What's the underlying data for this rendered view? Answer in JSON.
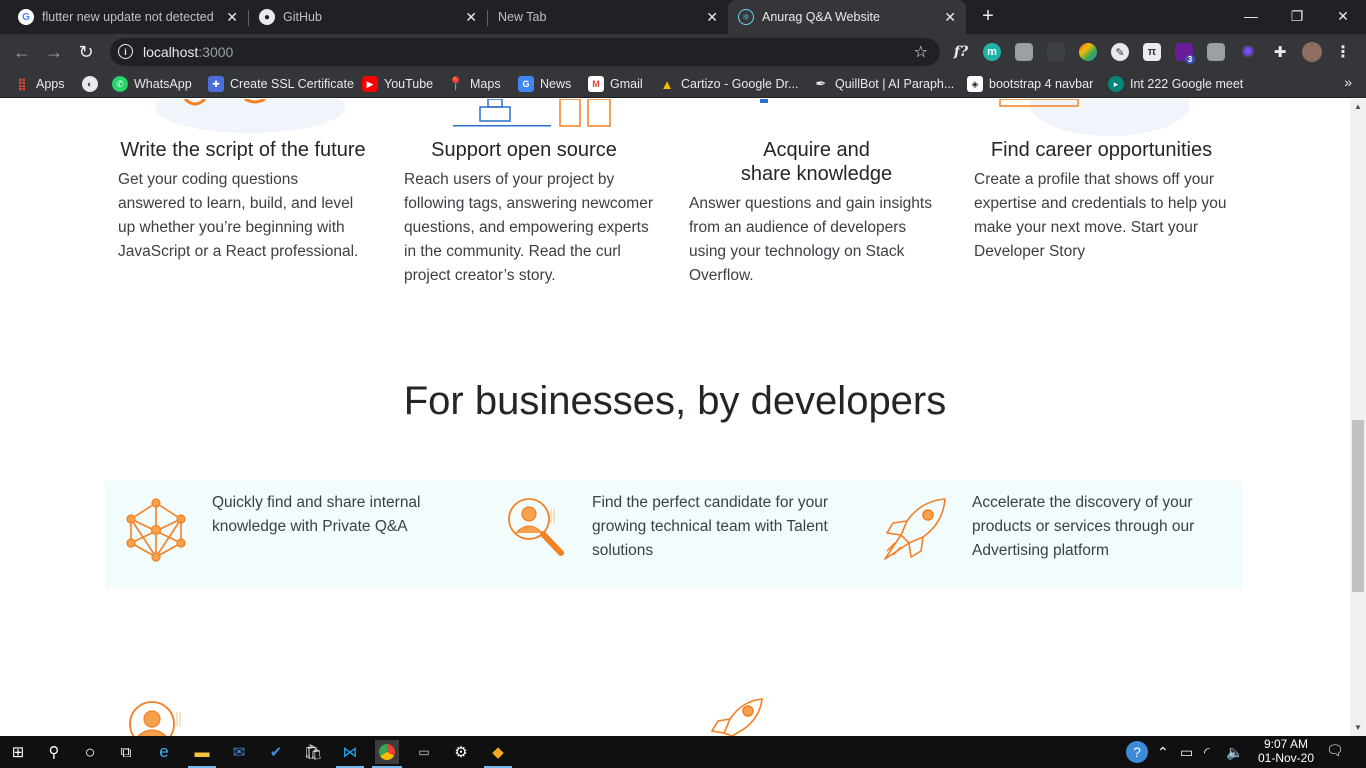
{
  "browser": {
    "tabs": [
      {
        "title": "flutter new update not detected",
        "favicon": "google-icon"
      },
      {
        "title": "GitHub",
        "favicon": "github-icon"
      },
      {
        "title": "New Tab",
        "favicon": ""
      },
      {
        "title": "Anurag Q&A Website",
        "favicon": "react-icon"
      }
    ],
    "url_host": "localhost",
    "url_port": ":3000",
    "bookmarks": [
      {
        "label": "Apps",
        "icon": "apps-grid-icon"
      },
      {
        "label": "",
        "icon": "globe-icon"
      },
      {
        "label": "WhatsApp",
        "icon": "whatsapp-icon"
      },
      {
        "label": "Create SSL Certificate",
        "icon": "puzzle-icon"
      },
      {
        "label": "YouTube",
        "icon": "youtube-icon"
      },
      {
        "label": "Maps",
        "icon": "maps-icon"
      },
      {
        "label": "News",
        "icon": "news-icon"
      },
      {
        "label": "Gmail",
        "icon": "gmail-icon"
      },
      {
        "label": "Cartizo - Google Dr...",
        "icon": "google-drive-icon"
      },
      {
        "label": "QuillBot | AI Paraph...",
        "icon": "quillbot-icon"
      },
      {
        "label": "bootstrap 4 navbar",
        "icon": "codepen-icon"
      },
      {
        "label": "Int 222 Google meet",
        "icon": "meet-icon"
      }
    ],
    "extension_badge": "3"
  },
  "features": [
    {
      "title": "Write the script of the future",
      "desc": "Get your coding questions answered to learn, build, and level up whether you’re beginning with JavaScript or a React professional."
    },
    {
      "title": "Support open source",
      "desc": "Reach users of your project by following tags, answering newcomer questions, and empowering experts in the community. Read the curl project creator’s story."
    },
    {
      "title": "Acquire and share knowledge",
      "desc": "Answer questions and gain insights from an audience of developers using your technology on Stack Overflow."
    },
    {
      "title": "Find career opportunities",
      "desc": "Create a profile that shows off your expertise and credentials to help you make your next move. Start your Developer Story"
    }
  ],
  "business": {
    "title": "For businesses, by developers",
    "items": [
      {
        "text": "Quickly find and share internal knowledge with Private Q&A",
        "icon": "network-icon"
      },
      {
        "text": "Find the perfect candidate for your growing technical team with Talent solutions",
        "icon": "candidate-search-icon"
      },
      {
        "text": "Accelerate the discovery of your products or services through our Advertising platform",
        "icon": "rocket-icon"
      }
    ]
  },
  "taskbar": {
    "time": "9:07 AM",
    "date": "01-Nov-20"
  },
  "colors": {
    "accent_orange": "#f48024",
    "band_bg": "#f2fcfd",
    "chrome_dark": "#202124",
    "chrome_mid": "#35363a"
  }
}
